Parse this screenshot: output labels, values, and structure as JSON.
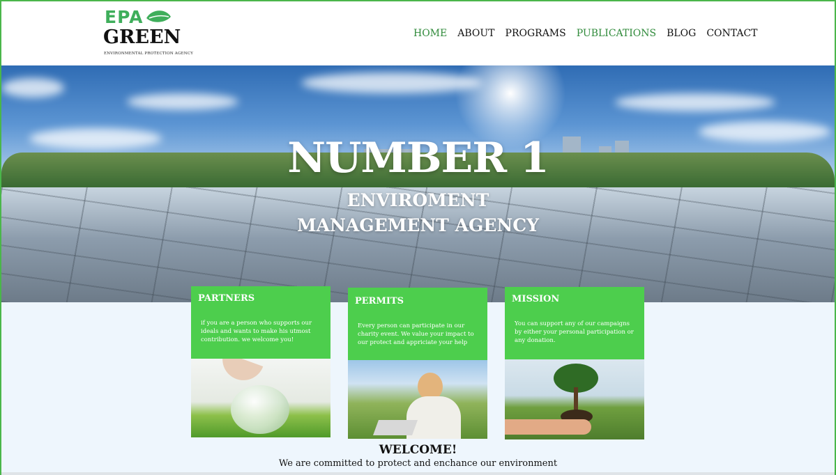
{
  "logo": {
    "epa": "EPA",
    "green": "GREEN",
    "tagline": "ENVIRONMENTAL PROTECTION AGENCY",
    "icon": "leaf-icon"
  },
  "nav": {
    "items": [
      {
        "label": "HOME",
        "active": true
      },
      {
        "label": "ABOUT",
        "active": false
      },
      {
        "label": "PROGRAMS",
        "active": false
      },
      {
        "label": "PUBLICATIONS",
        "active": true
      },
      {
        "label": "BLOG",
        "active": false
      },
      {
        "label": "CONTACT",
        "active": false
      }
    ]
  },
  "hero": {
    "title": "NUMBER 1",
    "subtitle": "ENVIROMENT MANAGEMENT AGENCY"
  },
  "cards": [
    {
      "title": "PARTNERS",
      "text": "if you are a person who supports our ideals and wants to make his utmost contribution. we welcome you!"
    },
    {
      "title": "PERMITS",
      "text": "Every person can participate in our charity event. We value your impact to our protect and appriciate your help"
    },
    {
      "title": "MISSION",
      "text": "You can support any of our campaigns by either your personal participation or any donation."
    }
  ],
  "welcome": {
    "title": "WELCOME!",
    "subtitle": "We are committed to protect and enchance our environment"
  },
  "colors": {
    "accent_green": "#4dce4d",
    "nav_active": "#2f8a3a",
    "logo_green": "#3fae5b",
    "page_bg": "#eef6fd"
  }
}
